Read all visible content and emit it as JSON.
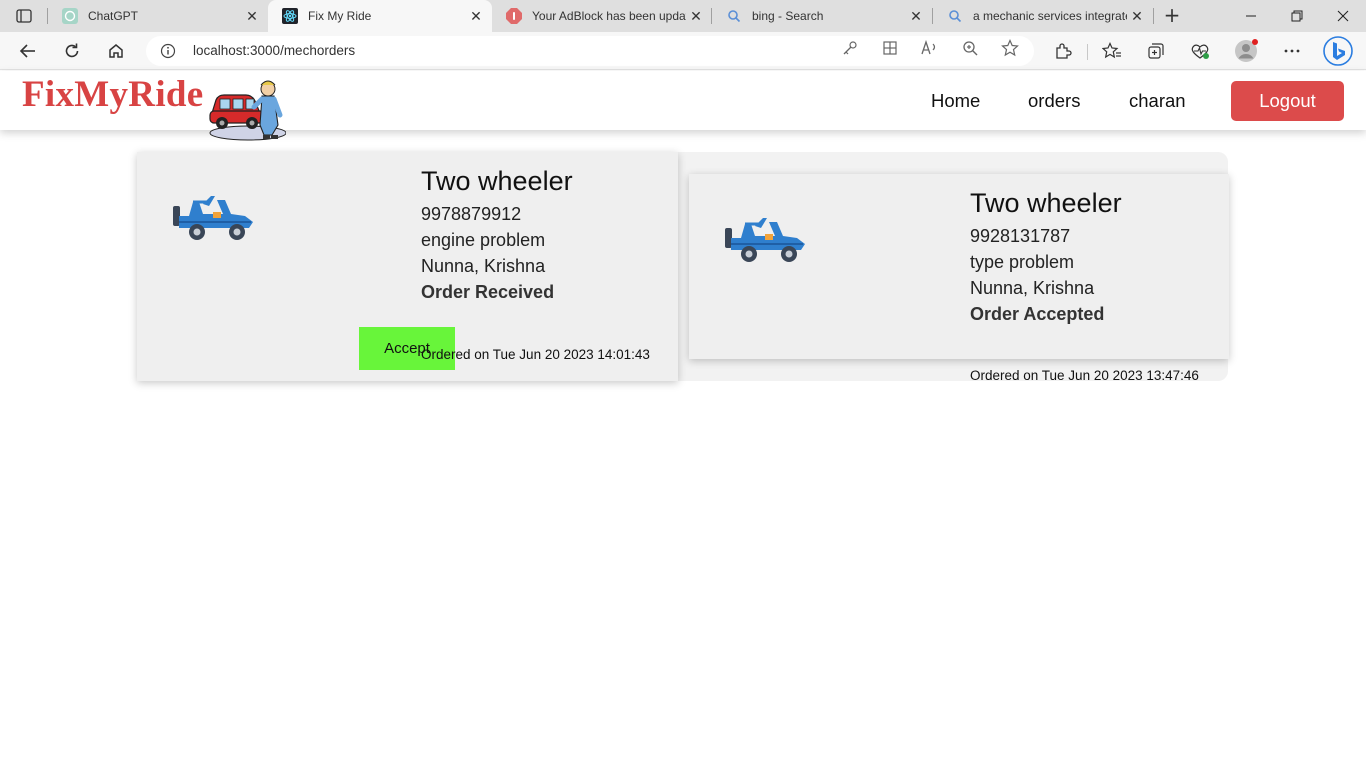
{
  "browser": {
    "tabs": [
      {
        "title": "ChatGPT",
        "icon": "chatgpt-icon"
      },
      {
        "title": "Fix My Ride",
        "icon": "react-icon",
        "active": true
      },
      {
        "title": "Your AdBlock has been updat",
        "icon": "adblock-icon"
      },
      {
        "title": "bing - Search",
        "icon": "search-icon"
      },
      {
        "title": "a mechanic services integrate",
        "icon": "search-icon"
      }
    ],
    "url": "localhost:3000/mechorders"
  },
  "header": {
    "brand": "FixMyRide",
    "nav": {
      "home": "Home",
      "orders": "orders",
      "user": "charan"
    },
    "logout": "Logout"
  },
  "orders": [
    {
      "vehicle": "Two wheeler",
      "phone": "9978879912",
      "problem": "engine problem",
      "location": "Nunna, Krishna",
      "status": "Order Received",
      "ordered_on": "Ordered on Tue Jun 20 2023 14:01:43",
      "action": "Accept"
    },
    {
      "vehicle": "Two wheeler",
      "phone": "9928131787",
      "problem": "type problem",
      "location": "Nunna, Krishna",
      "status": "Order Accepted",
      "ordered_on": "Ordered on Tue Jun 20 2023 13:47:46"
    }
  ],
  "colors": {
    "brand": "#d84343",
    "logout": "#dc4b4b",
    "accept": "#68f53a"
  }
}
